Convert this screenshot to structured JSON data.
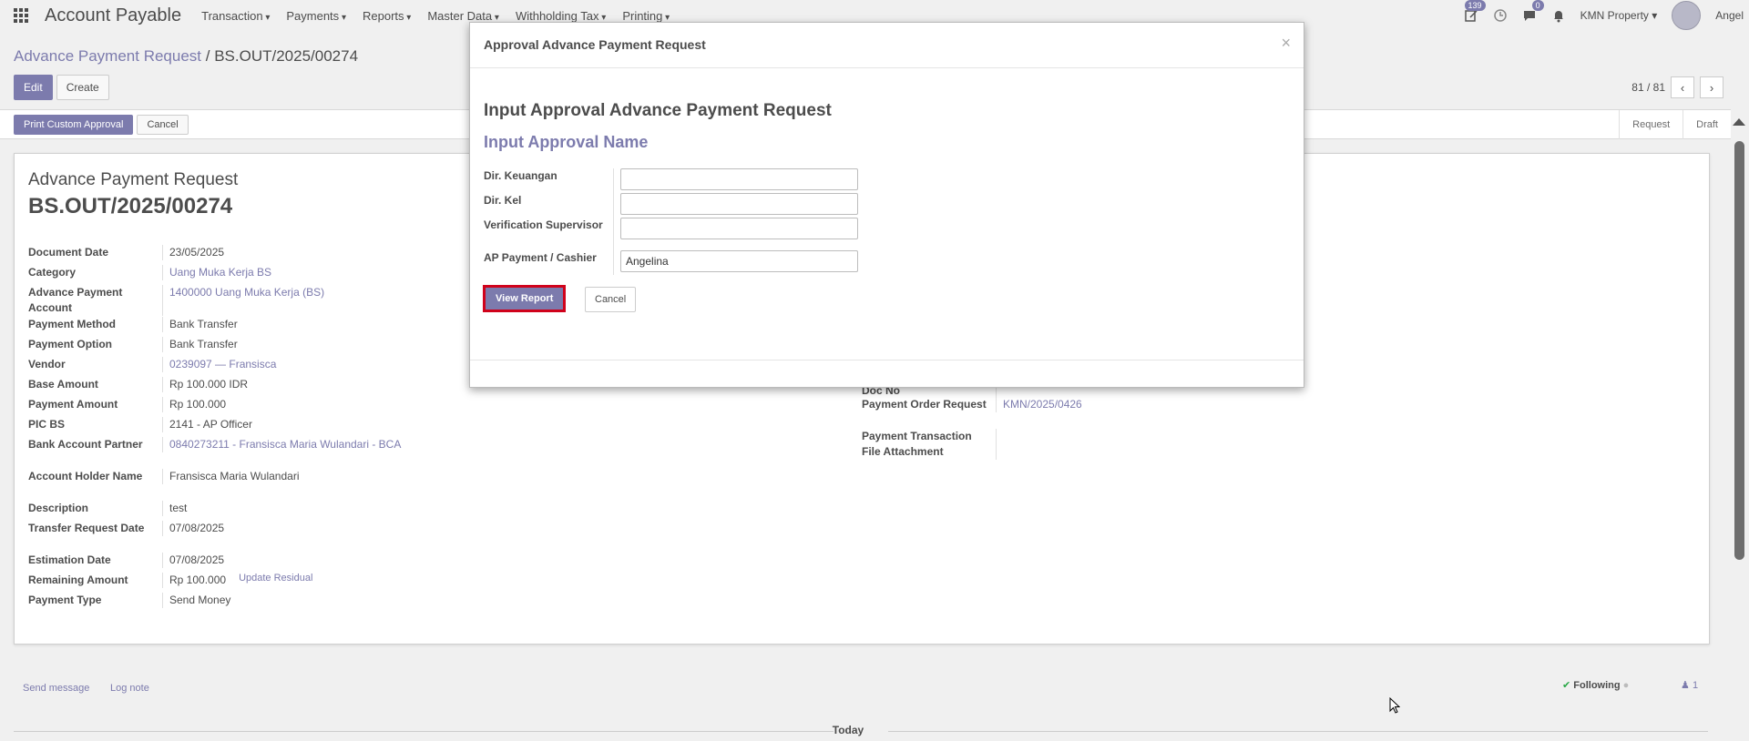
{
  "navbar": {
    "brand": "Account Payable",
    "menu": [
      "Transaction",
      "Payments",
      "Reports",
      "Master Data",
      "Withholding Tax",
      "Printing"
    ],
    "activity_badge": "139",
    "chat_badge": "0",
    "company": "KMN Property",
    "user": "Angel"
  },
  "breadcrumb": {
    "parent": "Advance Payment Request",
    "separator": "/",
    "current": "BS.OUT/2025/00274"
  },
  "control": {
    "edit": "Edit",
    "create": "Create",
    "pager": "81 / 81"
  },
  "statusbar": {
    "print": "Print Custom Approval",
    "cancel": "Cancel",
    "stages": [
      "Request",
      "Draft"
    ]
  },
  "sheet": {
    "title": "Advance Payment Request",
    "number": "BS.OUT/2025/00274",
    "left_fields": [
      {
        "label": "Document Date",
        "value": "23/05/2025"
      },
      {
        "label": "Category",
        "value": "Uang Muka Kerja BS"
      },
      {
        "label": "Advance Payment Account",
        "value": "1400000 Uang Muka Kerja (BS)"
      },
      {
        "label": "Payment Method",
        "value": "Bank Transfer"
      },
      {
        "label": "Payment Option",
        "value": "Bank Transfer"
      },
      {
        "label": "Vendor",
        "value": "0239097 — Fransisca"
      },
      {
        "label": "Base Amount",
        "value": "Rp 100.000  IDR"
      },
      {
        "label": "Payment Amount",
        "value": "Rp 100.000"
      },
      {
        "label": "PIC BS",
        "value": "2141 - AP Officer"
      },
      {
        "label": "Bank Account Partner",
        "value": "0840273211 - Fransisca Maria Wulandari - BCA"
      },
      {
        "label": "Account Holder Name",
        "value": "Fransisca Maria Wulandari"
      },
      {
        "label": "Description",
        "value": "test"
      },
      {
        "label": "Transfer Request Date",
        "value": "07/08/2025"
      },
      {
        "label": "Estimation Date",
        "value": "07/08/2025"
      },
      {
        "label": "Remaining Amount",
        "value": "Rp 100.000"
      },
      {
        "label": "Payment Type",
        "value": "Send Money"
      }
    ],
    "update_residual": "Update Residual",
    "right_fields": [
      {
        "label": "Doc No",
        "value": ""
      },
      {
        "label": "Payment Order Request",
        "value": "KMN/2025/0426"
      },
      {
        "label": "Payment Transaction File Attachment",
        "value": ""
      }
    ]
  },
  "chatter": {
    "send_message": "Send message",
    "log_note": "Log note",
    "following": "Following",
    "followers": "1",
    "today": "Today"
  },
  "modal": {
    "title": "Approval Advance Payment Request",
    "close": "×",
    "heading": "Input Approval Advance Payment Request",
    "subheading": "Input Approval Name",
    "fields": [
      {
        "label": "Dir. Keuangan",
        "value": ""
      },
      {
        "label": "Dir. Kel",
        "value": ""
      },
      {
        "label": "Verification Supervisor",
        "value": ""
      },
      {
        "label": "AP Payment / Cashier",
        "value": "Angelina"
      }
    ],
    "view_report": "View Report",
    "cancel": "Cancel"
  }
}
